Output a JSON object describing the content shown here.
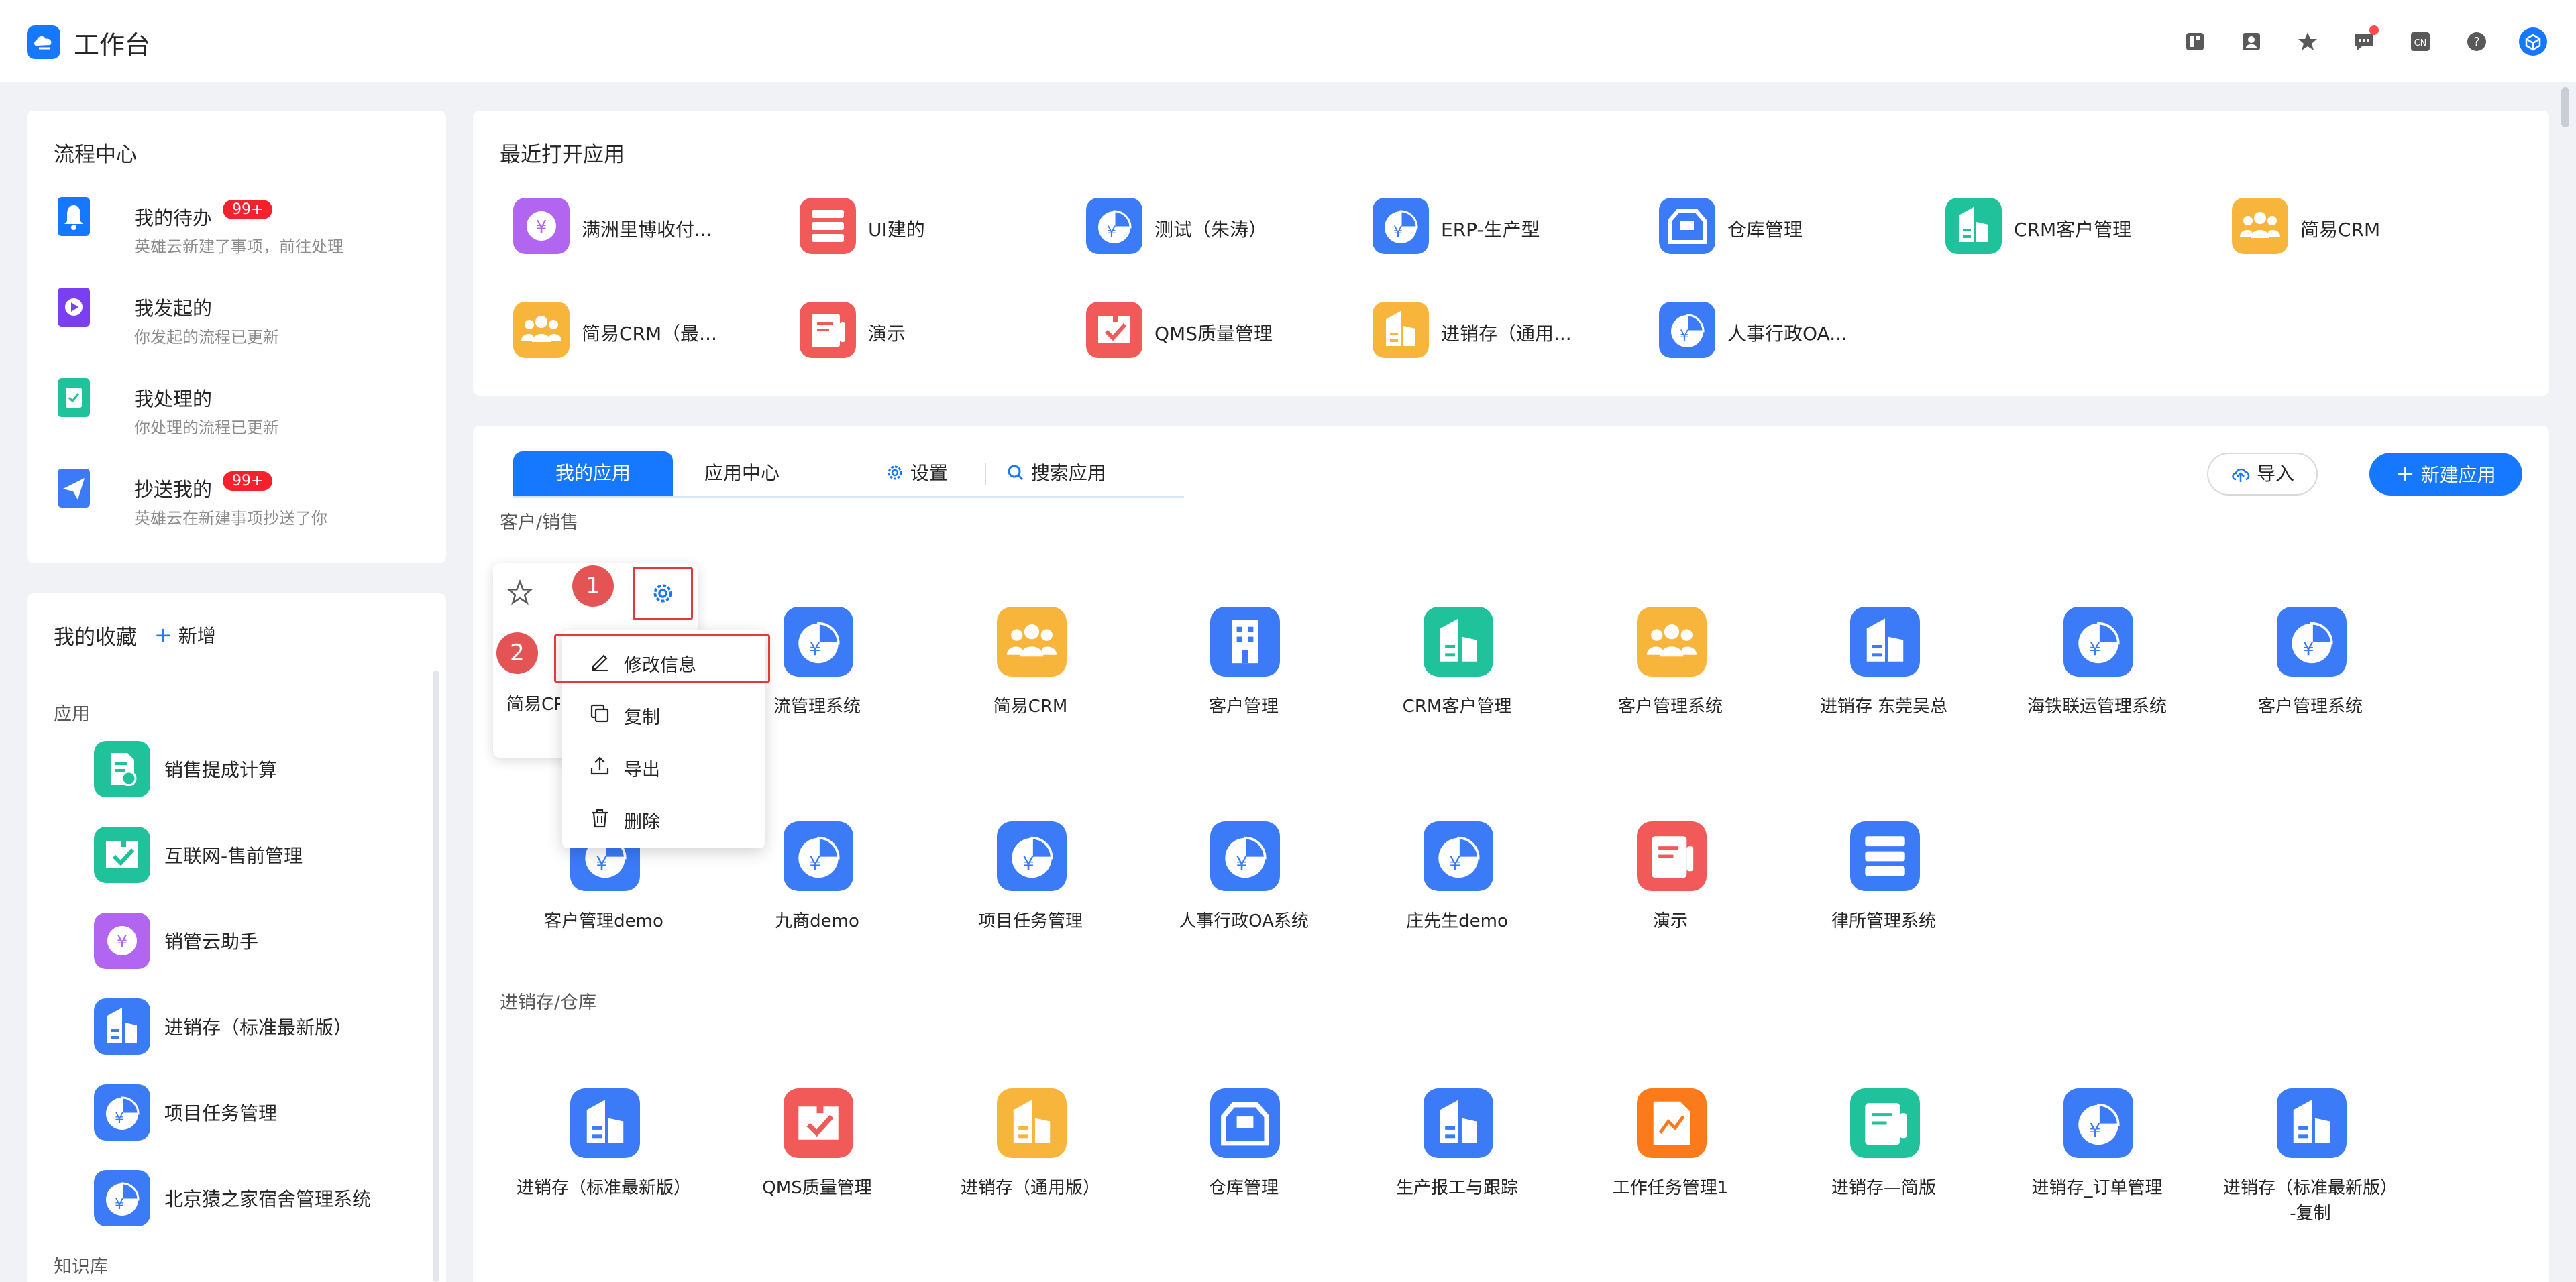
{
  "header": {
    "title": "工作台",
    "icons": [
      "layout-icon",
      "contact-icon",
      "star-icon",
      "message-icon",
      "language-icon",
      "help-icon",
      "avatar-icon"
    ],
    "language_label": "CN"
  },
  "process_center": {
    "title": "流程中心",
    "items": [
      {
        "name": "我的待办",
        "desc": "英雄云新建了事项，前往处理",
        "badge": "99+",
        "icon": "bell-icon",
        "color": "#1677ff"
      },
      {
        "name": "我发起的",
        "desc": "你发起的流程已更新",
        "badge": "",
        "icon": "play-icon",
        "color": "#7b3ff2"
      },
      {
        "name": "我处理的",
        "desc": "你处理的流程已更新",
        "badge": "",
        "icon": "check-doc-icon",
        "color": "#1fc29a"
      },
      {
        "name": "抄送我的",
        "desc": "英雄云在新建事项抄送了你",
        "badge": "99+",
        "icon": "send-icon",
        "color": "#3b7bf7"
      }
    ]
  },
  "favorites": {
    "title": "我的收藏",
    "add_label": "新增",
    "section_apps": "应用",
    "section_kb": "知识库",
    "items": [
      {
        "label": "销售提成计算",
        "icon": "doc-yen-icon",
        "color": "#1fc29a"
      },
      {
        "label": "互联网-售前管理",
        "icon": "puzzle-check-icon",
        "color": "#1fc29a"
      },
      {
        "label": "销管云助手",
        "icon": "yen-circle-icon",
        "color": "#b265f0"
      },
      {
        "label": "进销存（标准最新版）",
        "icon": "building-doc-icon",
        "color": "#3b7bf7"
      },
      {
        "label": "项目任务管理",
        "icon": "pie-yen-icon",
        "color": "#3b7bf7"
      },
      {
        "label": "北京猿之家宿舍管理系统",
        "icon": "pie-yen-icon",
        "color": "#3b7bf7"
      }
    ]
  },
  "recent": {
    "title": "最近打开应用",
    "items": [
      {
        "label": "满洲里博收付...",
        "icon": "yen-circle-icon",
        "color": "#b265f0"
      },
      {
        "label": "UI建的",
        "icon": "list-icon",
        "color": "#f25a5a"
      },
      {
        "label": "测试（朱涛）",
        "icon": "pie-yen-icon",
        "color": "#3b7bf7"
      },
      {
        "label": "ERP-生产型",
        "icon": "pie-yen-icon",
        "color": "#3b7bf7"
      },
      {
        "label": "仓库管理",
        "icon": "box-icon",
        "color": "#3b7bf7"
      },
      {
        "label": "CRM客户管理",
        "icon": "building-doc-icon",
        "color": "#1fc29a"
      },
      {
        "label": "简易CRM",
        "icon": "people-icon",
        "color": "#f7b53b"
      },
      {
        "label": "简易CRM（最...",
        "icon": "people-icon",
        "color": "#f7b53b"
      },
      {
        "label": "演示",
        "icon": "doc-lines-icon",
        "color": "#f25a5a"
      },
      {
        "label": "QMS质量管理",
        "icon": "puzzle-check-icon",
        "color": "#f25a5a"
      },
      {
        "label": "进销存（通用...",
        "icon": "building-doc-icon",
        "color": "#f7b53b"
      },
      {
        "label": "人事行政OA...",
        "icon": "pie-yen-icon",
        "color": "#3b7bf7"
      }
    ]
  },
  "my_apps": {
    "tab_active": "我的应用",
    "tab_center": "应用中心",
    "settings_label": "设置",
    "search_placeholder": "搜索应用",
    "import_label": "导入",
    "new_label": "新建应用",
    "groups": [
      {
        "title": "客户/销售",
        "apps": [
          {
            "label": "简易CRM",
            "icon": "people-icon",
            "color": "#f7b53b"
          },
          {
            "label": "流管理系统",
            "icon": "pie-yen-icon",
            "color": "#3b7bf7"
          },
          {
            "label": "简易CRM",
            "icon": "people-icon",
            "color": "#f7b53b"
          },
          {
            "label": "客户管理",
            "icon": "building-icon",
            "color": "#3b7bf7"
          },
          {
            "label": "CRM客户管理",
            "icon": "building-doc-icon",
            "color": "#1fc29a"
          },
          {
            "label": "客户管理系统",
            "icon": "people-icon",
            "color": "#f7b53b"
          },
          {
            "label": "进销存 东莞吴总",
            "icon": "building-doc-icon",
            "color": "#3b7bf7"
          },
          {
            "label": "海铁联运管理系统",
            "icon": "pie-yen-icon",
            "color": "#3b7bf7"
          },
          {
            "label": "客户管理系统",
            "icon": "pie-yen-icon",
            "color": "#3b7bf7"
          },
          {
            "label": "客户管理demo",
            "icon": "pie-yen-icon",
            "color": "#3b7bf7"
          },
          {
            "label": "九商demo",
            "icon": "pie-yen-icon",
            "color": "#3b7bf7"
          },
          {
            "label": "项目任务管理",
            "icon": "pie-yen-icon",
            "color": "#3b7bf7"
          },
          {
            "label": "人事行政OA系统",
            "icon": "pie-yen-icon",
            "color": "#3b7bf7"
          },
          {
            "label": "庄先生demo",
            "icon": "pie-yen-icon",
            "color": "#3b7bf7"
          },
          {
            "label": "演示",
            "icon": "doc-lines-icon",
            "color": "#f25a5a"
          },
          {
            "label": "律所管理系统",
            "icon": "list-icon",
            "color": "#3b7bf7"
          }
        ]
      },
      {
        "title": "进销存/仓库",
        "apps": [
          {
            "label": "进销存（标准最新版）",
            "icon": "building-doc-icon",
            "color": "#3b7bf7"
          },
          {
            "label": "QMS质量管理",
            "icon": "puzzle-check-icon",
            "color": "#f25a5a"
          },
          {
            "label": "进销存（通用版）",
            "icon": "building-doc-icon",
            "color": "#f7b53b"
          },
          {
            "label": "仓库管理",
            "icon": "box-icon",
            "color": "#3b7bf7"
          },
          {
            "label": "生产报工与跟踪",
            "icon": "building-doc-icon",
            "color": "#3b7bf7"
          },
          {
            "label": "工作任务管理1",
            "icon": "chart-doc-icon",
            "color": "#fa7a1c"
          },
          {
            "label": "进销存—简版",
            "icon": "doc-lines-icon",
            "color": "#1fc29a"
          },
          {
            "label": "进销存_订单管理",
            "icon": "pie-yen-icon",
            "color": "#3b7bf7"
          },
          {
            "label": "进销存（标准最新版）",
            "label2": "-复制",
            "icon": "building-doc-icon",
            "color": "#3b7bf7"
          }
        ]
      }
    ]
  },
  "context_menu": {
    "step1": "1",
    "step2": "2",
    "items": [
      {
        "label": "修改信息",
        "icon": "edit-icon"
      },
      {
        "label": "复制",
        "icon": "copy-icon"
      },
      {
        "label": "导出",
        "icon": "export-icon"
      },
      {
        "label": "删除",
        "icon": "delete-icon"
      }
    ]
  }
}
